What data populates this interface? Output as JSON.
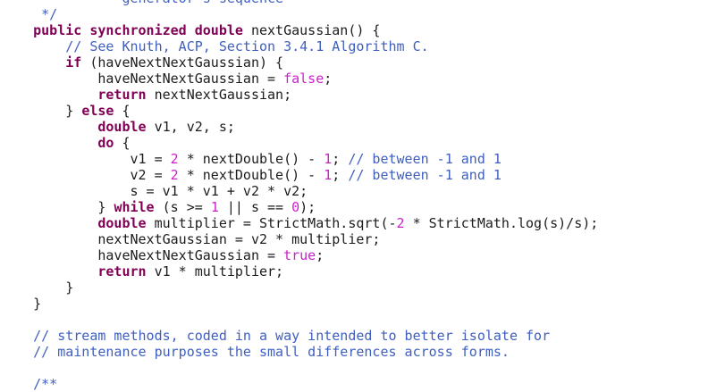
{
  "colors": {
    "background": "#ffffff",
    "text": "#1c1c1c",
    "keyword": "#7f0055",
    "comment": "#3f5fbf",
    "literal": "#cc22cc"
  },
  "code": {
    "lines": [
      [
        {
          "t": "     * ",
          "c": "cm"
        },
        {
          "t": "        generator's sequence",
          "c": "cm"
        }
      ],
      [
        {
          "t": "     */",
          "c": "cm"
        }
      ],
      [
        {
          "t": "    "
        },
        {
          "t": "public",
          "c": "kw"
        },
        {
          "t": " "
        },
        {
          "t": "synchronized",
          "c": "kw"
        },
        {
          "t": " "
        },
        {
          "t": "double",
          "c": "kw"
        },
        {
          "t": " nextGaussian() {"
        }
      ],
      [
        {
          "t": "        "
        },
        {
          "t": "// See Knuth, ACP, Section 3.4.1 Algorithm C.",
          "c": "cm"
        }
      ],
      [
        {
          "t": "        "
        },
        {
          "t": "if",
          "c": "kw"
        },
        {
          "t": " (haveNextNextGaussian) {"
        }
      ],
      [
        {
          "t": "            haveNextNextGaussian = "
        },
        {
          "t": "false",
          "c": "bo"
        },
        {
          "t": ";"
        }
      ],
      [
        {
          "t": "            "
        },
        {
          "t": "return",
          "c": "kw"
        },
        {
          "t": " nextNextGaussian;"
        }
      ],
      [
        {
          "t": "        } "
        },
        {
          "t": "else",
          "c": "kw"
        },
        {
          "t": " {"
        }
      ],
      [
        {
          "t": "            "
        },
        {
          "t": "double",
          "c": "kw"
        },
        {
          "t": " v1, v2, s;"
        }
      ],
      [
        {
          "t": "            "
        },
        {
          "t": "do",
          "c": "kw"
        },
        {
          "t": " {"
        }
      ],
      [
        {
          "t": "                v1 = "
        },
        {
          "t": "2",
          "c": "nm"
        },
        {
          "t": " * nextDouble() - "
        },
        {
          "t": "1",
          "c": "nm"
        },
        {
          "t": "; "
        },
        {
          "t": "// between -1 and 1",
          "c": "cm"
        }
      ],
      [
        {
          "t": "                v2 = "
        },
        {
          "t": "2",
          "c": "nm"
        },
        {
          "t": " * nextDouble() - "
        },
        {
          "t": "1",
          "c": "nm"
        },
        {
          "t": "; "
        },
        {
          "t": "// between -1 and 1",
          "c": "cm"
        }
      ],
      [
        {
          "t": "                s = v1 * v1 + v2 * v2;"
        }
      ],
      [
        {
          "t": "            } "
        },
        {
          "t": "while",
          "c": "kw"
        },
        {
          "t": " (s >= "
        },
        {
          "t": "1",
          "c": "nm"
        },
        {
          "t": " || s == "
        },
        {
          "t": "0",
          "c": "nm"
        },
        {
          "t": ");"
        }
      ],
      [
        {
          "t": "            "
        },
        {
          "t": "double",
          "c": "kw"
        },
        {
          "t": " multiplier = StrictMath.sqrt(-"
        },
        {
          "t": "2",
          "c": "nm"
        },
        {
          "t": " * StrictMath.log(s)/s);"
        }
      ],
      [
        {
          "t": "            nextNextGaussian = v2 * multiplier;"
        }
      ],
      [
        {
          "t": "            haveNextNextGaussian = "
        },
        {
          "t": "true",
          "c": "bo"
        },
        {
          "t": ";"
        }
      ],
      [
        {
          "t": "            "
        },
        {
          "t": "return",
          "c": "kw"
        },
        {
          "t": " v1 * multiplier;"
        }
      ],
      [
        {
          "t": "        }"
        }
      ],
      [
        {
          "t": "    }"
        }
      ],
      [
        {
          "t": ""
        }
      ],
      [
        {
          "t": "    "
        },
        {
          "t": "// stream methods, coded in a way intended to better isolate for",
          "c": "cm"
        }
      ],
      [
        {
          "t": "    "
        },
        {
          "t": "// maintenance purposes the small differences across forms.",
          "c": "cm"
        }
      ],
      [
        {
          "t": ""
        }
      ],
      [
        {
          "t": "    "
        },
        {
          "t": "/**",
          "c": "cm"
        }
      ]
    ]
  }
}
